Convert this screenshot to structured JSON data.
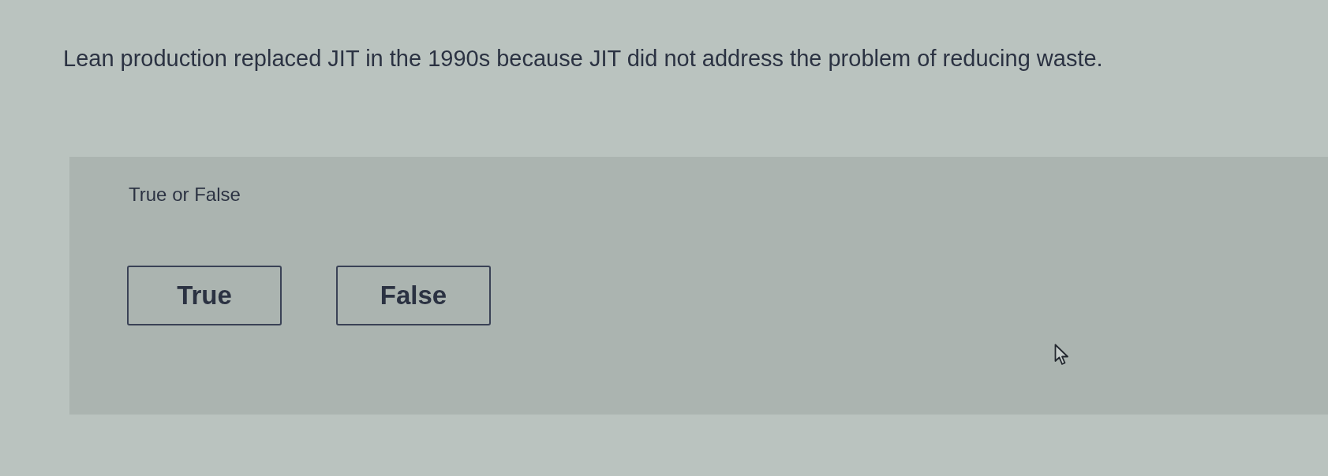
{
  "question": {
    "text": "Lean production replaced JIT in the 1990s because JIT did not address the problem of reducing waste."
  },
  "answer_panel": {
    "prompt": "True or False",
    "options": [
      {
        "label": "True",
        "selected": false
      },
      {
        "label": "False",
        "selected": false
      }
    ]
  }
}
